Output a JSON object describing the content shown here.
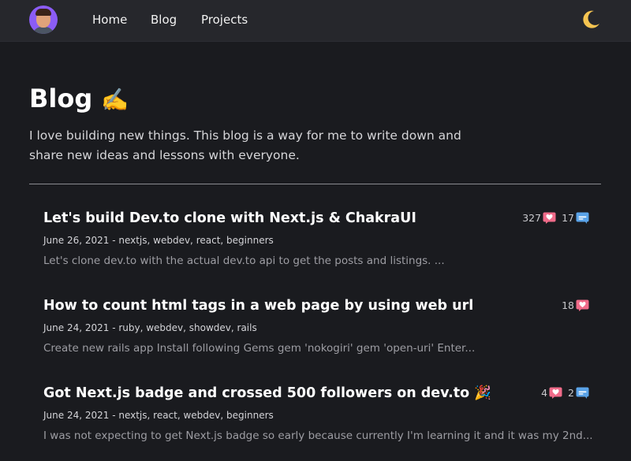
{
  "nav": {
    "items": [
      {
        "label": "Home"
      },
      {
        "label": "Blog"
      },
      {
        "label": "Projects"
      }
    ]
  },
  "hero": {
    "title": "Blog",
    "title_emoji": "✍️",
    "description": "I love building new things. This blog is a way for me to write down and share new ideas and lessons with everyone."
  },
  "posts": [
    {
      "title": "Let's build Dev.to clone with Next.js & ChakraUI",
      "meta": "June 26, 2021 - nextjs, webdev, react, beginners",
      "excerpt": "Let's clone dev.to with the actual dev.to api to get the posts and listings. ...",
      "reactions": "327",
      "comments": "17"
    },
    {
      "title": "How to count html tags in a web page by using web url",
      "meta": "June 24, 2021 - ruby, webdev, showdev, rails",
      "excerpt": "Create new rails app Install following Gems gem 'nokogiri' gem 'open-uri' Enter...",
      "reactions": "18"
    },
    {
      "title": "Got Next.js badge and crossed 500 followers on dev.to 🎉",
      "meta": "June 24, 2021 - nextjs, react, webdev, beginners",
      "excerpt": "I was not expecting to get Next.js badge so early because currently I'm learning it and it was my 2nd...",
      "reactions": "4",
      "comments": "2"
    }
  ],
  "icons": {
    "avatar": "avatar",
    "theme_toggle": "moon-icon",
    "reactions": "heart-icon",
    "comments": "comment-icon"
  },
  "colors": {
    "background": "#1a1b1f",
    "topbar": "#26272c",
    "heart": "#f06b89",
    "comment": "#5aa3e8",
    "moon": "#f5c451"
  }
}
